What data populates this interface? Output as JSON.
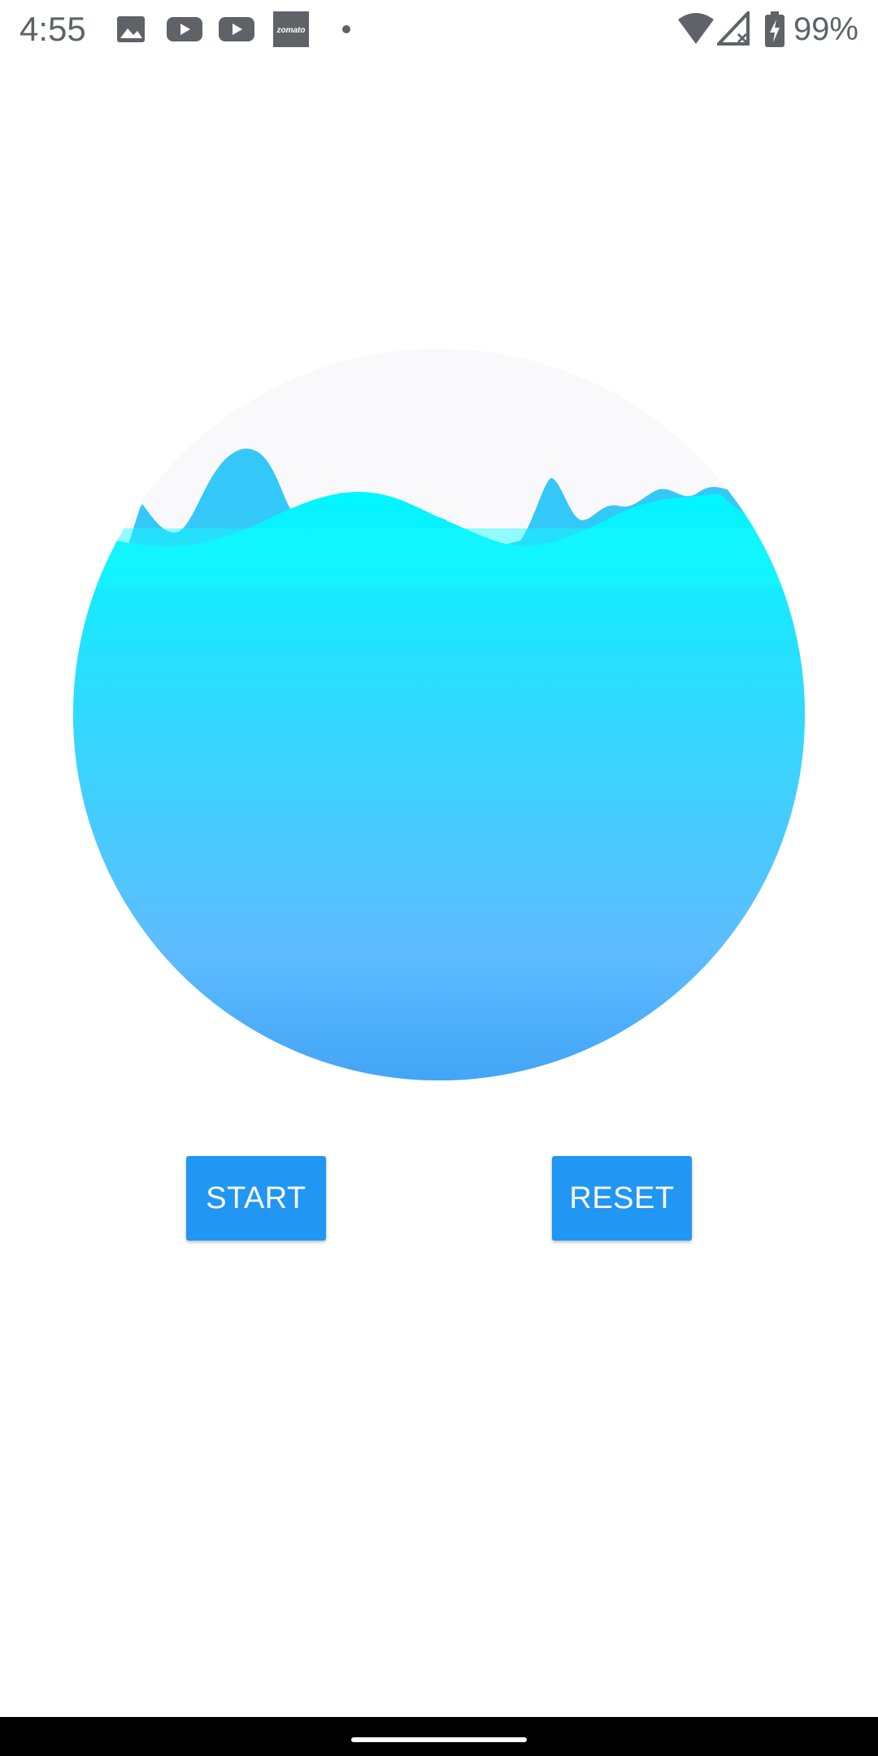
{
  "status_bar": {
    "time": "4:55",
    "battery": "99%",
    "notification_icons": [
      "image-icon",
      "youtube-icon",
      "youtube-icon",
      "zomato-icon",
      "dot-icon"
    ],
    "zomato_label": "zomato",
    "system_icons": [
      "wifi-icon",
      "signal-icon",
      "battery-charging-icon"
    ]
  },
  "wave": {
    "colors": {
      "water_top": "#00f7ff",
      "water_bottom": "#42a5f5",
      "back_wave": "#33c8f7",
      "bowl_background": "#f9f9fb"
    }
  },
  "buttons": {
    "start_label": "START",
    "reset_label": "RESET",
    "color": "#2196f3"
  }
}
